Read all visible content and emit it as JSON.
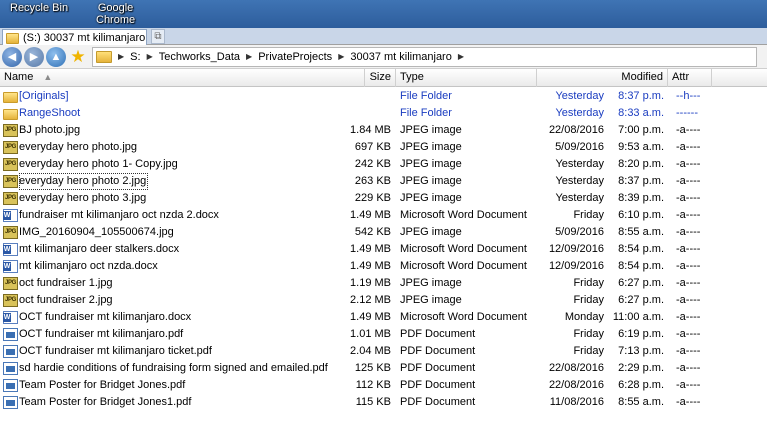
{
  "desktop": {
    "recycle_bin": "Recycle Bin",
    "chrome_line1": "Google",
    "chrome_line2": "Chrome"
  },
  "tab": {
    "label": "(S:) 30037 mt kilimanjaro",
    "add_glyph": "⧉"
  },
  "address": {
    "crumbs": [
      "S:",
      "Techworks_Data",
      "PrivateProjects",
      "30037 mt kilimanjaro"
    ]
  },
  "columns": {
    "name": "Name",
    "size": "Size",
    "type": "Type",
    "modified": "Modified",
    "attr": "Attr"
  },
  "files": [
    {
      "name": "[Originals]",
      "size": "",
      "type": "File Folder",
      "date": "Yesterday",
      "time": "8:37 p.m.",
      "attr": "--h---",
      "icon": "folder-icon"
    },
    {
      "name": "RangeShoot",
      "size": "",
      "type": "File Folder",
      "date": "Yesterday",
      "time": "8:33 a.m.",
      "attr": "------",
      "icon": "folder-icon"
    },
    {
      "name": "BJ photo.jpg",
      "size": "1.84 MB",
      "type": "JPEG image",
      "date": "22/08/2016",
      "time": "7:00 p.m.",
      "attr": "-a----",
      "icon": "jpeg-icon"
    },
    {
      "name": "everyday hero photo.jpg",
      "size": "697 KB",
      "type": "JPEG image",
      "date": "5/09/2016",
      "time": "9:53 a.m.",
      "attr": "-a----",
      "icon": "jpeg-icon"
    },
    {
      "name": "everyday hero photo 1- Copy.jpg",
      "size": "242 KB",
      "type": "JPEG image",
      "date": "Yesterday",
      "time": "8:20 p.m.",
      "attr": "-a----",
      "icon": "jpeg-icon"
    },
    {
      "name": "everyday hero photo 2.jpg",
      "size": "263 KB",
      "type": "JPEG image",
      "date": "Yesterday",
      "time": "8:37 p.m.",
      "attr": "-a----",
      "icon": "jpeg-icon"
    },
    {
      "name": "everyday hero photo 3.jpg",
      "size": "229 KB",
      "type": "JPEG image",
      "date": "Yesterday",
      "time": "8:39 p.m.",
      "attr": "-a----",
      "icon": "jpeg-icon"
    },
    {
      "name": "fundraiser mt kilimanjaro   oct  nzda 2.docx",
      "size": "1.49 MB",
      "type": "Microsoft Word Document",
      "date": "Friday",
      "time": "6:10 p.m.",
      "attr": "-a----",
      "icon": "word-icon"
    },
    {
      "name": "IMG_20160904_105500674.jpg",
      "size": "542 KB",
      "type": "JPEG image",
      "date": "5/09/2016",
      "time": "8:55 a.m.",
      "attr": "-a----",
      "icon": "jpeg-icon"
    },
    {
      "name": "mt kilimanjaro   deer stalkers.docx",
      "size": "1.49 MB",
      "type": "Microsoft Word Document",
      "date": "12/09/2016",
      "time": "8:54 p.m.",
      "attr": "-a----",
      "icon": "word-icon"
    },
    {
      "name": "mt kilimanjaro   oct  nzda.docx",
      "size": "1.49 MB",
      "type": "Microsoft Word Document",
      "date": "12/09/2016",
      "time": "8:54 p.m.",
      "attr": "-a----",
      "icon": "word-icon"
    },
    {
      "name": "oct fundraiser 1.jpg",
      "size": "1.19 MB",
      "type": "JPEG image",
      "date": "Friday",
      "time": "6:27 p.m.",
      "attr": "-a----",
      "icon": "jpeg-icon"
    },
    {
      "name": "oct fundraiser 2.jpg",
      "size": "2.12 MB",
      "type": "JPEG image",
      "date": "Friday",
      "time": "6:27 p.m.",
      "attr": "-a----",
      "icon": "jpeg-icon"
    },
    {
      "name": "OCT fundraiser mt kilimanjaro.docx",
      "size": "1.49 MB",
      "type": "Microsoft Word Document",
      "date": "Monday",
      "time": "11:00 a.m.",
      "attr": "-a----",
      "icon": "word-icon"
    },
    {
      "name": "OCT fundraiser mt kilimanjaro.pdf",
      "size": "1.01 MB",
      "type": "PDF Document",
      "date": "Friday",
      "time": "6:19 p.m.",
      "attr": "-a----",
      "icon": "pdf-icon"
    },
    {
      "name": "OCT fundraiser mt kilimanjaro ticket.pdf",
      "size": "2.04 MB",
      "type": "PDF Document",
      "date": "Friday",
      "time": "7:13 p.m.",
      "attr": "-a----",
      "icon": "pdf-icon"
    },
    {
      "name": "sd hardie conditions of fundraising form  signed and emailed.pdf",
      "size": "125 KB",
      "type": "PDF Document",
      "date": "22/08/2016",
      "time": "2:29 p.m.",
      "attr": "-a----",
      "icon": "pdf-icon"
    },
    {
      "name": "Team Poster for Bridget Jones.pdf",
      "size": "112 KB",
      "type": "PDF Document",
      "date": "22/08/2016",
      "time": "6:28 p.m.",
      "attr": "-a----",
      "icon": "pdf-icon"
    },
    {
      "name": "Team Poster for Bridget Jones1.pdf",
      "size": "115 KB",
      "type": "PDF Document",
      "date": "11/08/2016",
      "time": "8:55 a.m.",
      "attr": "-a----",
      "icon": "pdf-icon"
    }
  ]
}
